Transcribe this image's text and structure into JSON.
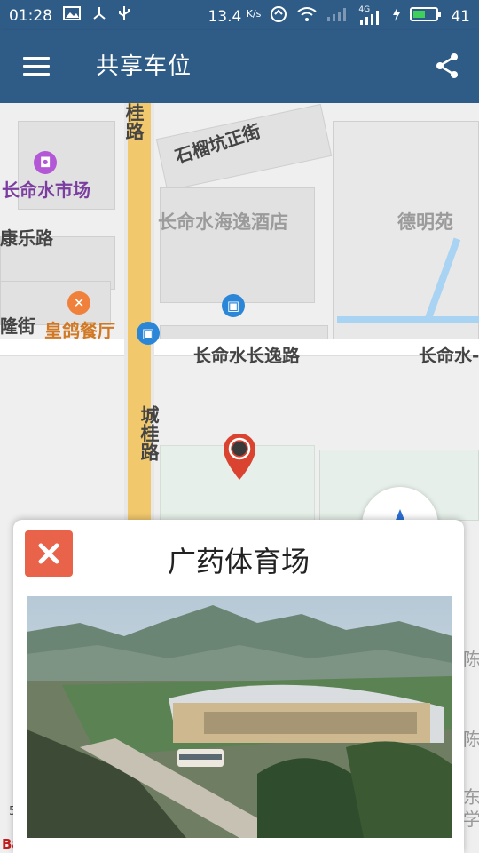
{
  "status_bar": {
    "time": "01:28",
    "speed": "13.4",
    "speed_unit": "K/s",
    "network": "4G",
    "battery": "41"
  },
  "app_bar": {
    "title": "共享车位"
  },
  "map": {
    "roads": {
      "main_road_top": "桂路",
      "main_road_bottom": "城桂路",
      "shiliu_street": "石榴坑正街",
      "changyi_road": "长命水长逸路",
      "changyi_road_right": "长命水-",
      "kangle_road": "康乐路",
      "long_street": "隆街"
    },
    "places": {
      "market": "长命水市场",
      "hotel": "长命水海逸酒店",
      "deming": "德明苑",
      "restaurant": "皇鸽餐厅"
    },
    "edge_text": {
      "right_1": "陈",
      "right_2": "陈",
      "right_3": "东",
      "right_4": "学"
    },
    "scale_label": "5",
    "logo": "Ba"
  },
  "place_card": {
    "title": "广药体育场"
  },
  "colors": {
    "primary": "#2f5c87",
    "road": "#f2c86d",
    "pin": "#d9432f",
    "close": "#e8634a",
    "compass_arrow": "#2b6fd6"
  }
}
